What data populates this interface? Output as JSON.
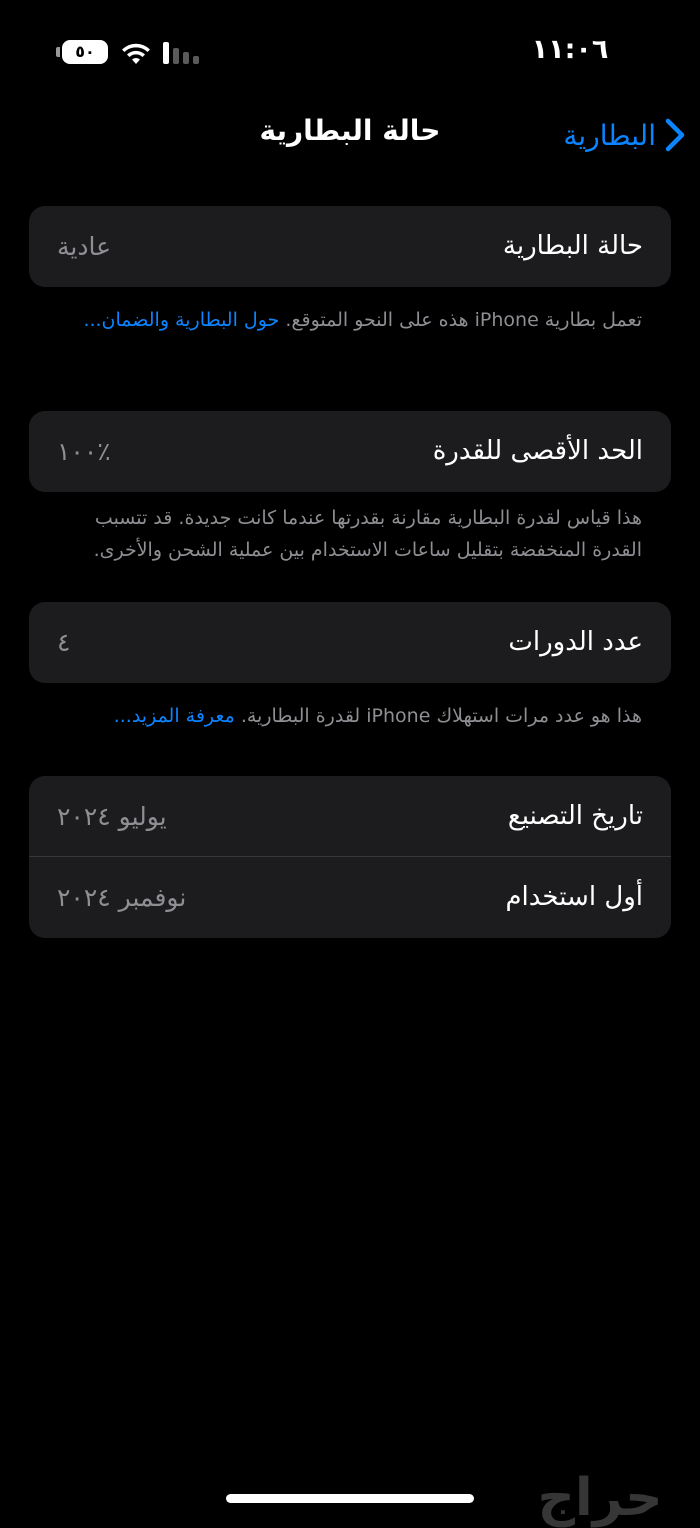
{
  "status_bar": {
    "time": "١١:٠٦",
    "battery_level": "٥٠",
    "icons": [
      "battery-icon",
      "wifi-icon",
      "cellular-signal-icon"
    ]
  },
  "nav": {
    "back_label": "البطارية",
    "title": "حالة البطارية"
  },
  "battery_health": {
    "label": "حالة البطارية",
    "value": "عادية",
    "footnote_text": "تعمل بطارية iPhone هذه على النحو المتوقع.",
    "footnote_link": "حول البطارية والضمان..."
  },
  "maximum_capacity": {
    "label": "الحد الأقصى للقدرة",
    "value": "٪١٠٠",
    "footnote_text": "هذا قياس لقدرة البطارية مقارنة بقدرتها عندما كانت جديدة. قد تتسبب القدرة المنخفضة بتقليل ساعات الاستخدام بين عملية الشحن والأخرى."
  },
  "cycle_count": {
    "label": "عدد الدورات",
    "value": "٤",
    "footnote_text": "هذا هو عدد مرات استهلاك iPhone لقدرة البطارية.",
    "footnote_link": "معرفة المزيد..."
  },
  "dates": {
    "manufacture_label": "تاريخ التصنيع",
    "manufacture_value": "يوليو ٢٠٢٤",
    "first_use_label": "أول استخدام",
    "first_use_value": "نوفمبر ٢٠٢٤"
  },
  "watermark": "حراج",
  "colors": {
    "background": "#000000",
    "card": "#1c1c1e",
    "accent": "#0a84ff",
    "secondary_text": "#8e8e93"
  }
}
